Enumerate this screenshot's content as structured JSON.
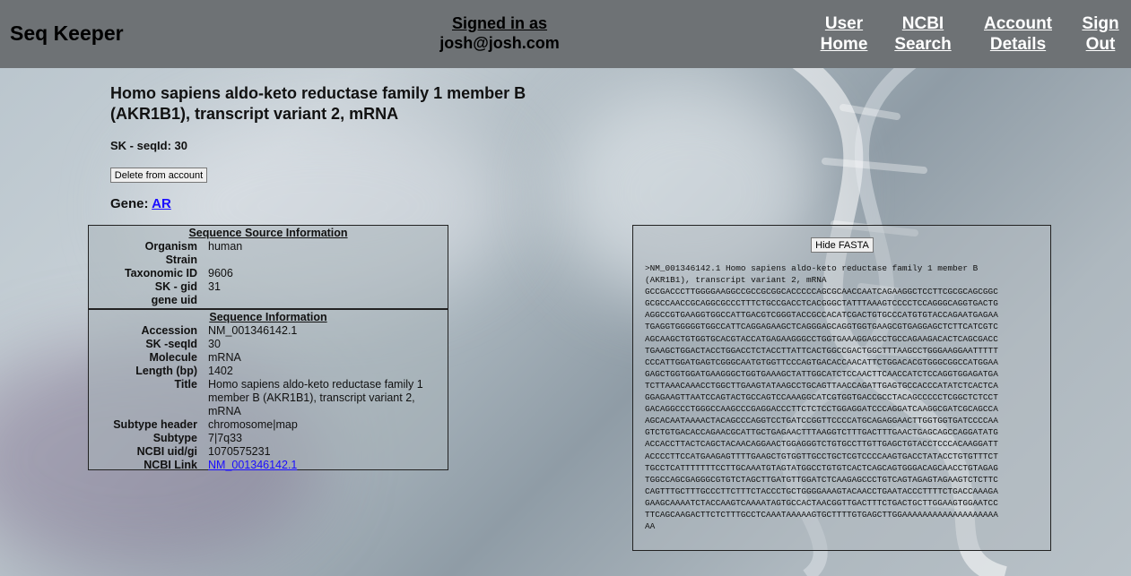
{
  "header": {
    "brand": "Seq Keeper",
    "signed_in_label": "Signed in as",
    "signed_in_email": "josh@josh.com",
    "nav": {
      "user_home": [
        "User",
        "Home"
      ],
      "ncbi_search": [
        "NCBI",
        "Search"
      ],
      "account_details": [
        "Account",
        "Details"
      ],
      "sign_out": [
        "Sign",
        "Out"
      ]
    }
  },
  "page": {
    "title": "Homo sapiens aldo-keto reductase family 1 member B (AKR1B1), transcript variant 2, mRNA",
    "seq_id_label": "SK - seqId: 30",
    "delete_button": "Delete from account",
    "gene_label": "Gene:",
    "gene_link": "AR"
  },
  "source_info": {
    "heading": "Sequence Source Information",
    "rows": [
      {
        "label": "Organism",
        "value": "human"
      },
      {
        "label": "Strain",
        "value": ""
      },
      {
        "label": "Taxonomic ID",
        "value": "9606"
      },
      {
        "label": "SK - gid",
        "value": "31"
      },
      {
        "label": "gene uid",
        "value": ""
      }
    ]
  },
  "sequence_info": {
    "heading": "Sequence Information",
    "rows": [
      {
        "label": "Accession",
        "value": "NM_001346142.1"
      },
      {
        "label": "SK -seqId",
        "value": "30"
      },
      {
        "label": "Molecule",
        "value": "mRNA"
      },
      {
        "label": "Length (bp)",
        "value": "1402"
      },
      {
        "label": "Title",
        "value": "Homo sapiens aldo-keto reductase family 1 member B (AKR1B1), transcript variant 2, mRNA"
      },
      {
        "label": "Subtype header",
        "value": "chromosome|map"
      },
      {
        "label": "Subtype",
        "value": "7|7q33"
      },
      {
        "label": "NCBI uid/gi",
        "value": "1070575231"
      },
      {
        "label": "NCBI Link",
        "value": "NM_001346142.1"
      }
    ]
  },
  "fasta": {
    "hide_button": "Hide FASTA",
    "lines": [
      ">NM_001346142.1 Homo sapiens aldo-keto reductase family 1 member B",
      "(AKR1B1), transcript variant 2, mRNA",
      "GCCGACCCTTGGGGAAGGCCGCCGCGGCACCCCCAGCGCAACCAATCAGAAGGCTCCTTCGCGCAGCGGC",
      "GCGCCAACCGCAGGCGCCCTTTCTGCCGACCTCACGGGCTATTTAAAGTCCCCTCCAGGGCAGGTGACTG",
      "AGGCCGTGAAGGTGGCCATTGACGTCGGGTACCGCCACATCGACTGTGCCCATGTGTACCAGAATGAGAA",
      "TGAGGTGGGGGTGGCCATTCAGGAGAAGCTCAGGGAGCAGGTGGTGAAGCGTGAGGAGCTCTTCATCGTC",
      "AGCAAGCTGTGGTGCACGTACCATGAGAAGGGCCTGGTGAAAGGAGCCTGCCAGAAGACACTCAGCGACC",
      "TGAAGCTGGACTACCTGGACCTCTACCTTATTCACTGGCCGACTGGCTTTAAGCCTGGGAAGGAATTTTT",
      "CCCATTGGATGAGTCGGGCAATGTGGTTCCCAGTGACACCAACATTCTGGACACGTGGGCGGCCATGGAA",
      "GAGCTGGTGGATGAAGGGCTGGTGAAAGCTATTGGCATCTCCAACTTCAACCATCTCCAGGTGGAGATGA",
      "TCTTAAACAAACCTGGCTTGAAGTATAAGCCTGCAGTTAACCAGATTGAGTGCCACCCATATCTCACTCA",
      "GGAGAAGTTAATCCAGTACTGCCAGTCCAAAGGCATCGTGGTGACCGCCTACAGCCCCCTCGGCTCTCCT",
      "GACAGGCCCTGGGCCAAGCCCGAGGACCCTTCTCTCCTGGAGGATCCCAGGATCAAGGCGATCGCAGCCA",
      "AGCACAATAAAACTACAGCCCAGGTCCTGATCCGGTTCCCCATGCAGAGGAACTTGGTGGTGATCCCCAA",
      "GTCTGTGACACCAGAACGCATTGCTGAGAACTTTAAGGTCTTTGACTTTGAACTGAGCAGCCAGGATATG",
      "ACCACCTTACTCAGCTACAACAGGAACTGGAGGGTCTGTGCCTTGTTGAGCTGTACCTCCCACAAGGATT",
      "ACCCCTTCCATGAAGAGTTTTGAAGCTGTGGTTGCCTGCTCGTCCCCAAGTGACCTATACCTGTGTTTCT",
      "TGCCTCATTTTTTTCCTTGCAAATGTAGTATGGCCTGTGTCACTCAGCAGTGGGACAGCAACCTGTAGAG",
      "TGGCCAGCGAGGGCGTGTCTAGCTTGATGTTGGATCTCAAGAGCCCTGTCAGTAGAGTAGAAGTCTCTTC",
      "CAGTTTGCTTTGCCCTTCTTTCTACCCTGCTGGGGAAAGTACAACCTGAATACCCTTTTCTGACCAAAGA",
      "GAAGCAAAATCTACCAAGTCAAAATAGTGCCACTAACGGTTGACTTTCTGACTGCTTGGAAGTGGAATCC",
      "TTCAGCAAGACTTCTCTTTGCCTCAAATAAAAAGTGCTTTTGTGAGCTTGGAAAAAAAAAAAAAAAAAAA",
      "AA"
    ]
  }
}
